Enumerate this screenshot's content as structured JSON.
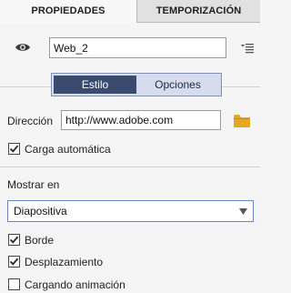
{
  "tabs": {
    "properties": "PROPIEDADES",
    "timing": "TEMPORIZACIÓN"
  },
  "name_field": {
    "value": "Web_2"
  },
  "segmented": {
    "style": "Estilo",
    "options": "Opciones",
    "selected": "Estilo"
  },
  "address": {
    "label": "Dirección",
    "value": "http://www.adobe.com"
  },
  "auto_load": {
    "label": "Carga automática",
    "checked": true
  },
  "show_in": {
    "label": "Mostrar en",
    "selected": "Diapositiva"
  },
  "border": {
    "label": "Borde",
    "checked": true
  },
  "scrolling": {
    "label": "Desplazamiento",
    "checked": true
  },
  "loading_animation": {
    "label": "Cargando animación",
    "checked": false
  },
  "colors": {
    "segment_active": "#3b4a6f",
    "segment_inactive": "#d6dcee",
    "folder": "#e5a823"
  },
  "icons": {
    "visibility": "eye-icon",
    "list_menu": "list-menu-icon",
    "browse": "folder-icon",
    "dropdown": "chevron-down-icon",
    "check": "checkmark-icon"
  }
}
